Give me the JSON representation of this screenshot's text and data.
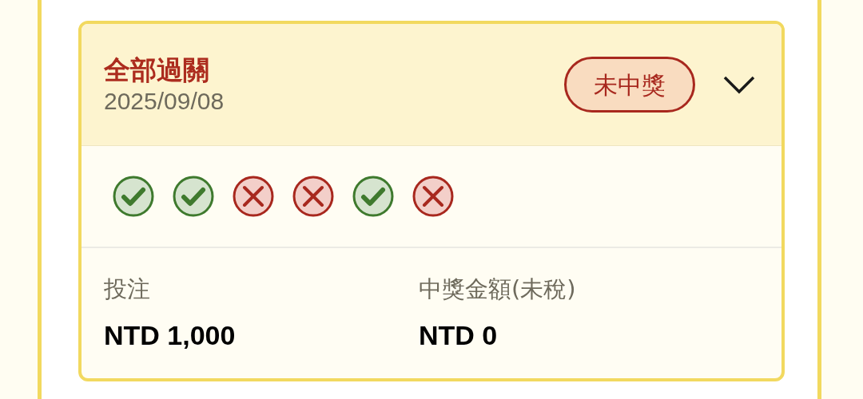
{
  "bet": {
    "title": "全部過關",
    "date": "2025/09/08",
    "status": "未中獎",
    "expanded": false,
    "legs": [
      {
        "kind": "win"
      },
      {
        "kind": "win"
      },
      {
        "kind": "loss"
      },
      {
        "kind": "loss"
      },
      {
        "kind": "win"
      },
      {
        "kind": "loss"
      }
    ],
    "stake": {
      "label": "投注",
      "value": "NTD 1,000"
    },
    "payout": {
      "label": "中獎金額(未稅)",
      "value": "NTD 0"
    }
  }
}
